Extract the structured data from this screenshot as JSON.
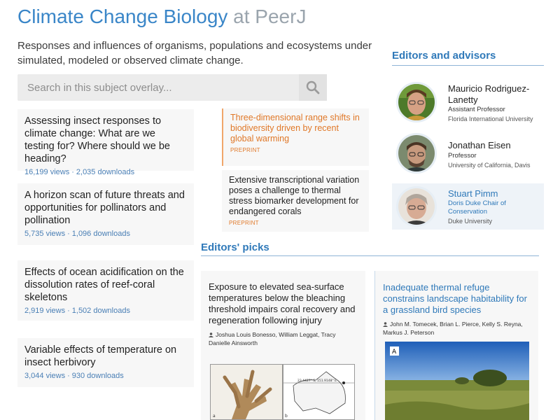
{
  "header": {
    "title": "Climate Change Biology",
    "title_suffix": "at PeerJ",
    "description": "Responses and influences of organisms, populations and ecosystems under simulated, modeled or observed climate change."
  },
  "search": {
    "placeholder": "Search in this subject overlay...",
    "icon": "search-icon"
  },
  "articles": [
    {
      "title": "Assessing insect responses to climate change: What are we testing for? Where should we be heading?",
      "views": "16,199 views",
      "downloads": "2,035 downloads"
    },
    {
      "title": "A horizon scan of future threats and opportunities for pollinators and pollination",
      "views": "5,735 views",
      "downloads": "1,096 downloads"
    },
    {
      "title": "Effects of ocean acidification on the dissolution rates of reef-coral skeletons",
      "views": "2,919 views",
      "downloads": "1,502 downloads"
    },
    {
      "title": "Variable effects of temperature on insect herbivory",
      "views": "3,044 views",
      "downloads": "930 downloads"
    }
  ],
  "separator": "·",
  "preprints": [
    {
      "title": "Three-dimensional range shifts in biodiversity driven by recent global warming",
      "tag": "PREPRINT"
    },
    {
      "title": "Extensive transcriptional variation poses a challenge to thermal stress biomarker development for endangered corals",
      "tag": "PREPRINT"
    }
  ],
  "editors_section": {
    "heading": "Editors and advisors"
  },
  "editors": [
    {
      "name_line1": "Mauricio Rodriguez-",
      "name_line2": "Lanetty",
      "role": "Assistant Professor",
      "affiliation": "Florida International University"
    },
    {
      "name_line1": "Jonathan Eisen",
      "role": "Professor",
      "affiliation": "University of California, Davis"
    },
    {
      "name_line1": "Stuart Pimm",
      "role_line1": "Doris Duke Chair of",
      "role_line2": "Conservation",
      "affiliation": "Duke University"
    }
  ],
  "picks_section": {
    "heading": "Editors' picks"
  },
  "picks": [
    {
      "title": "Exposure to elevated sea-surface temperatures below the bleaching threshold impairs coral recovery and regeneration following injury",
      "authors": "Joshua Louis Bonesso, William Leggat, Tracy Danielle Ainsworth",
      "figure_label_a": "a",
      "figure_label_b": "b",
      "map_coords": "23.4427° S, 151.9148° E"
    },
    {
      "title": "Inadequate thermal refuge constrains landscape habitability for a grassland bird species",
      "authors": "John M. Tomecek, Brian L. Pierce, Kelly S. Reyna, Markus J. Peterson",
      "photo_label": "A"
    }
  ],
  "colors": {
    "link_blue": "#2f79b9",
    "title_blue": "#3a86c8",
    "preprint_orange": "#e07828"
  }
}
